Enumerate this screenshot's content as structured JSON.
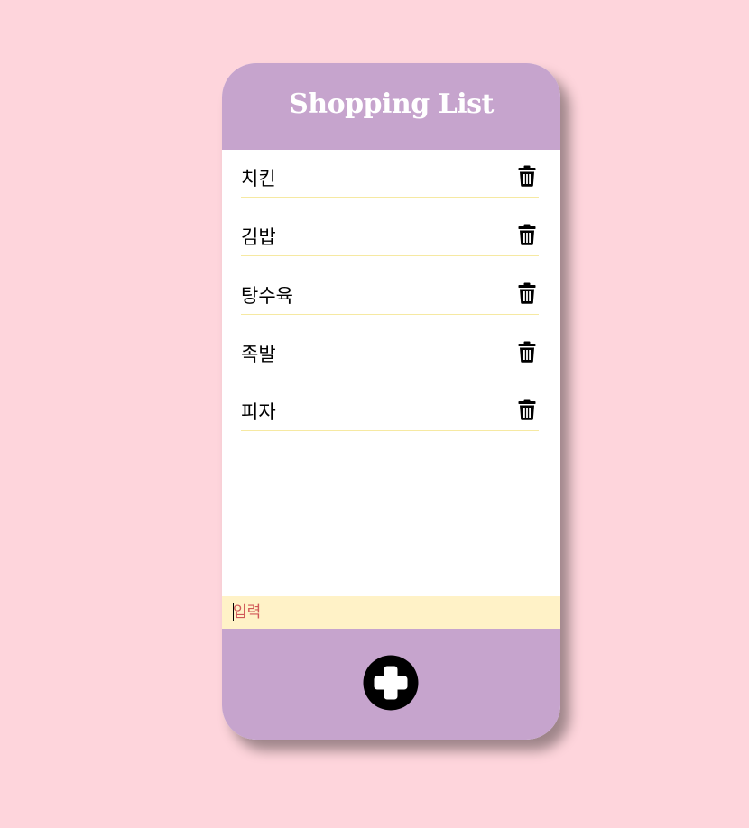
{
  "app": {
    "title": "Shopping List"
  },
  "list": {
    "items": [
      {
        "label": "치킨"
      },
      {
        "label": "김밥"
      },
      {
        "label": "탕수육"
      },
      {
        "label": "족발"
      },
      {
        "label": "피자"
      }
    ]
  },
  "input": {
    "placeholder": "입력",
    "value": ""
  },
  "icons": {
    "delete": "trash-icon",
    "add": "plus-circle-icon"
  },
  "colors": {
    "background": "#fed5dc",
    "header": "#c6a4cd",
    "footer": "#c6a4cd",
    "input_bar": "#fff2c7",
    "divider": "#f6e9a2",
    "placeholder": "#d05858"
  }
}
